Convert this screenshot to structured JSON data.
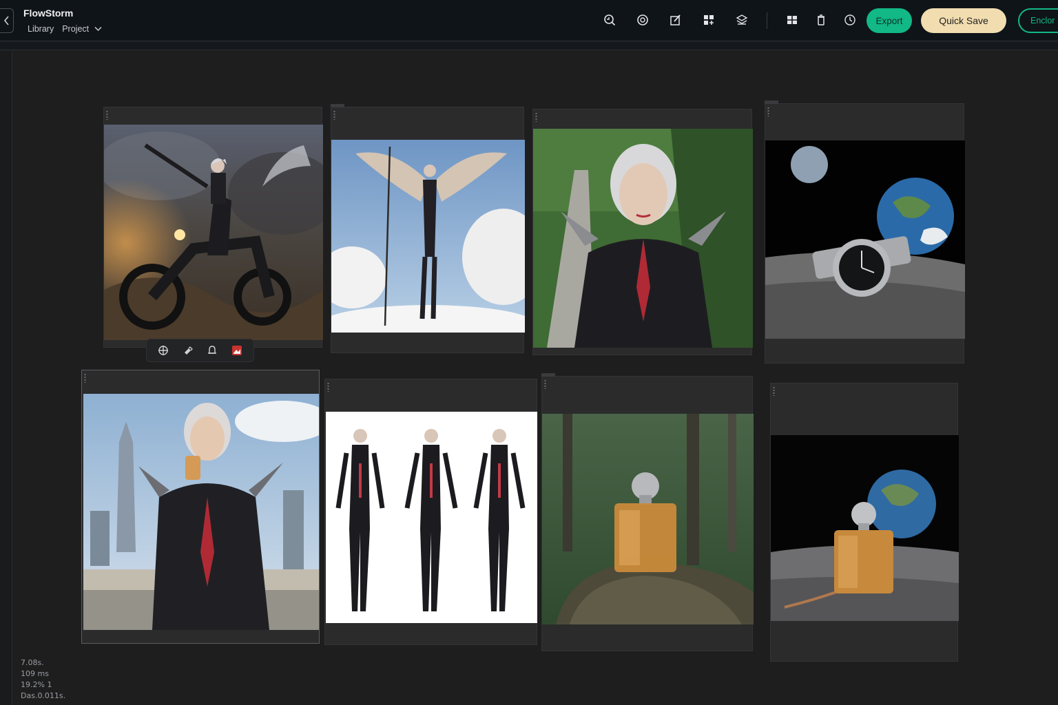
{
  "app": {
    "brand": "FlowStorm",
    "crumbs": [
      "Library",
      "Project"
    ]
  },
  "toolbar": {
    "tools": [
      "search-zoom-icon",
      "target-icon",
      "edit-icon",
      "grid-plus-icon",
      "layers-icon"
    ],
    "tools2": [
      "layout-icon",
      "trash-icon",
      "history-icon"
    ],
    "export_label": "Export",
    "quicksave_label": "Quick Save",
    "third_label": "Enclor",
    "accent": "#12b886",
    "quicksave_color": "#f1ddb0"
  },
  "floatbar": {
    "icons": [
      "move-icon",
      "eraser-icon",
      "bell-icon",
      "image-red-icon"
    ]
  },
  "cards": [
    {
      "image": "angel-biker",
      "caption": ""
    },
    {
      "image": "winged-spear-warrior",
      "caption": ""
    },
    {
      "image": "forest-path-portrait",
      "caption": ""
    },
    {
      "image": "watch-on-moon",
      "caption": ""
    },
    {
      "image": "city-selfie-warrior",
      "caption": ""
    },
    {
      "image": "character-turnaround",
      "caption": ""
    },
    {
      "image": "perfume-in-forest",
      "caption": ""
    },
    {
      "image": "perfume-on-moon",
      "caption": ""
    }
  ],
  "stats": [
    "7.08s.",
    "109 ms",
    "19.2% 1",
    "Das.0.011s."
  ]
}
